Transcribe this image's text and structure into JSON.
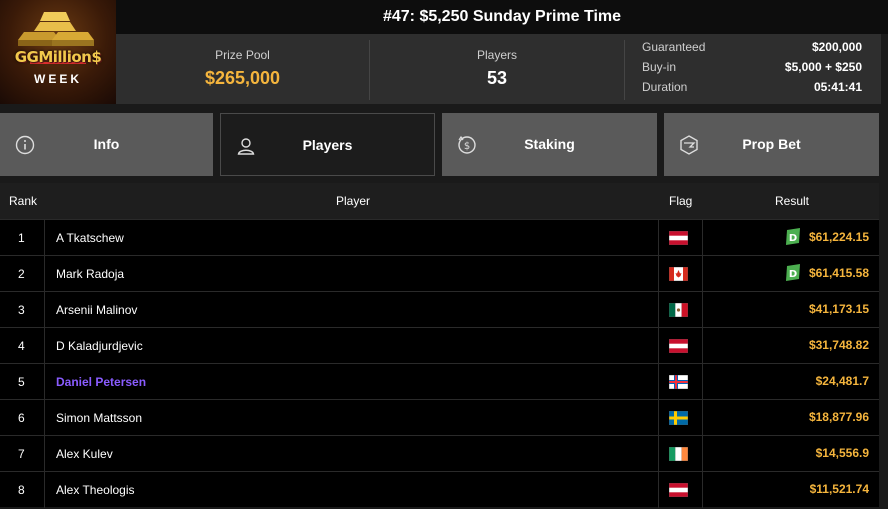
{
  "logo": {
    "text": "GGMillion$",
    "subtext": "WEEK"
  },
  "header": {
    "title": "#47: $5,250 Sunday Prime Time"
  },
  "prize_pool": {
    "label": "Prize Pool",
    "value": "$265,000"
  },
  "players_count": {
    "label": "Players",
    "value": "53"
  },
  "details": {
    "guaranteed_label": "Guaranteed",
    "guaranteed_value": "$200,000",
    "buyin_label": "Buy-in",
    "buyin_value": "$5,000 + $250",
    "duration_label": "Duration",
    "duration_value": "05:41:41"
  },
  "tabs": [
    {
      "label": "Info",
      "icon": "info-icon"
    },
    {
      "label": "Players",
      "icon": "user-icon",
      "active": true
    },
    {
      "label": "Staking",
      "icon": "staking-icon"
    },
    {
      "label": "Prop Bet",
      "icon": "prop-bet-icon"
    }
  ],
  "table": {
    "headers": {
      "rank": "Rank",
      "player": "Player",
      "flag": "Flag",
      "result": "Result"
    },
    "rows": [
      {
        "rank": "1",
        "player": "A Tkatschew",
        "flag": "austria",
        "result": "$61,224.15",
        "badge": "D"
      },
      {
        "rank": "2",
        "player": "Mark Radoja",
        "flag": "canada",
        "result": "$61,415.58",
        "badge": "D"
      },
      {
        "rank": "3",
        "player": "Arsenii Malinov",
        "flag": "mexico",
        "result": "$41,173.15"
      },
      {
        "rank": "4",
        "player": "D Kaladjurdjevic",
        "flag": "austria",
        "result": "$31,748.82"
      },
      {
        "rank": "5",
        "player": "Daniel Petersen",
        "flag": "faroe-islands",
        "result": "$24,481.7",
        "highlight": true
      },
      {
        "rank": "6",
        "player": "Simon Mattsson",
        "flag": "sweden",
        "result": "$18,877.96"
      },
      {
        "rank": "7",
        "player": "Alex Kulev",
        "flag": "ireland",
        "result": "$14,556.9"
      },
      {
        "rank": "8",
        "player": "Alex Theologis",
        "flag": "austria",
        "result": "$11,521.74"
      }
    ]
  },
  "colors": {
    "accent_gold": "#f5b53d",
    "highlight_purple": "#8a5cff",
    "badge_green": "#4caf50"
  }
}
